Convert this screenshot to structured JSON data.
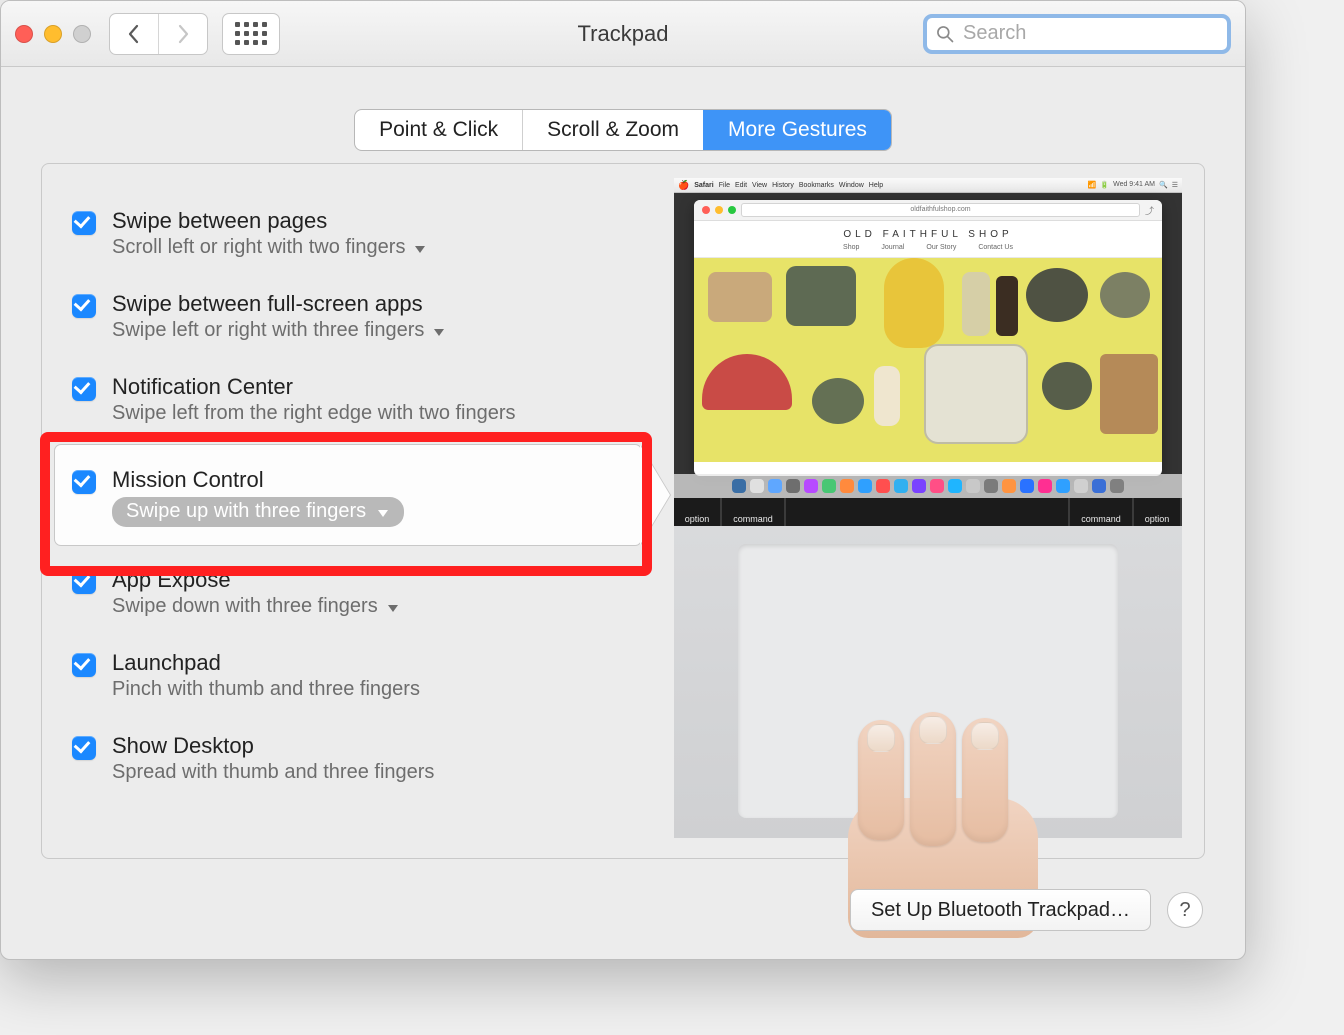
{
  "window_title": "Trackpad",
  "search": {
    "placeholder": "Search",
    "value": ""
  },
  "tabs": {
    "point_click": "Point & Click",
    "scroll_zoom": "Scroll & Zoom",
    "more_gestures": "More Gestures"
  },
  "options": {
    "swipe_pages": {
      "title": "Swipe between pages",
      "sub": "Scroll left or right with two fingers"
    },
    "swipe_apps": {
      "title": "Swipe between full-screen apps",
      "sub": "Swipe left or right with three fingers"
    },
    "notification_center": {
      "title": "Notification Center",
      "sub": "Swipe left from the right edge with two fingers"
    },
    "mission_control": {
      "title": "Mission Control",
      "sub": "Swipe up with three fingers"
    },
    "app_expose": {
      "title": "App Exposé",
      "sub": "Swipe down with three fingers"
    },
    "launchpad": {
      "title": "Launchpad",
      "sub": "Pinch with thumb and three fingers"
    },
    "show_desktop": {
      "title": "Show Desktop",
      "sub": "Spread with thumb and three fingers"
    }
  },
  "preview": {
    "menubar_app": "Safari",
    "menubar_items": [
      "File",
      "Edit",
      "View",
      "History",
      "Bookmarks",
      "Window",
      "Help"
    ],
    "menubar_time": "Wed 9:41 AM",
    "browser_url": "oldfaithfulshop.com",
    "shop_title": "OLD FAITHFUL SHOP",
    "shop_nav": [
      "Shop",
      "Journal",
      "Our Story",
      "Contact Us"
    ],
    "key_left1": "option",
    "key_left2": "command",
    "key_space": "",
    "key_right1": "command",
    "key_right2": "option"
  },
  "footer": {
    "bluetooth_button": "Set Up Bluetooth Trackpad…",
    "help": "?"
  }
}
